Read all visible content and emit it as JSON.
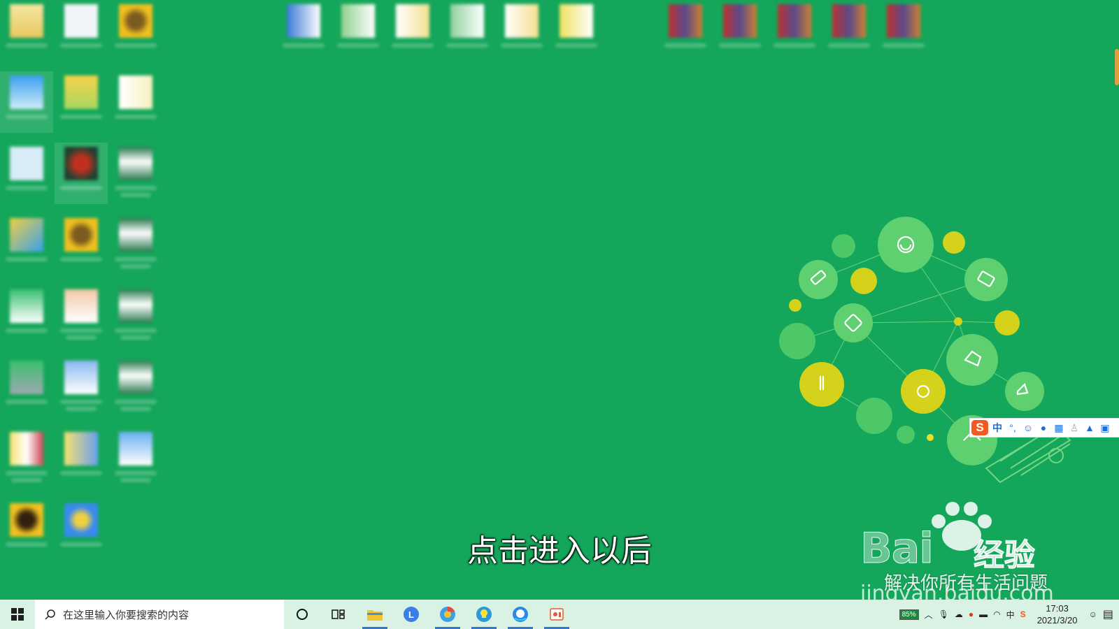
{
  "desktop": {
    "icon_count_left_columns": 21,
    "icon_count_top_row": 11
  },
  "ime": {
    "mode_label": "中",
    "punct_label": "°,"
  },
  "subtitle": "点击进入以后",
  "watermark": {
    "brand": "Bai",
    "brand_cn": "经验",
    "slogan": "解决你所有生活问题",
    "url": "jingyan.baidu.com"
  },
  "taskbar": {
    "search_placeholder": "在这里输入你要搜索的内容",
    "battery_percent": "85%",
    "ime_indicator": "中",
    "time": "17:03",
    "date": "2021/3/20"
  },
  "colors": {
    "wallpaper": "#14a65a",
    "taskbar": "#d9f2e3",
    "accent": "#2b7bd6"
  },
  "icons": [
    "windows-logo-icon",
    "search-icon",
    "cortana-icon",
    "task-view-icon",
    "file-explorer-icon",
    "app-l-icon",
    "browser-icon",
    "bulb-app-icon",
    "qq-browser-icon",
    "office-icon",
    "chevron-up-icon",
    "microphone-icon",
    "cloud-icon",
    "qq-icon",
    "battery-icon",
    "wifi-icon",
    "sogou-icon",
    "chat-icon",
    "notification-icon"
  ]
}
